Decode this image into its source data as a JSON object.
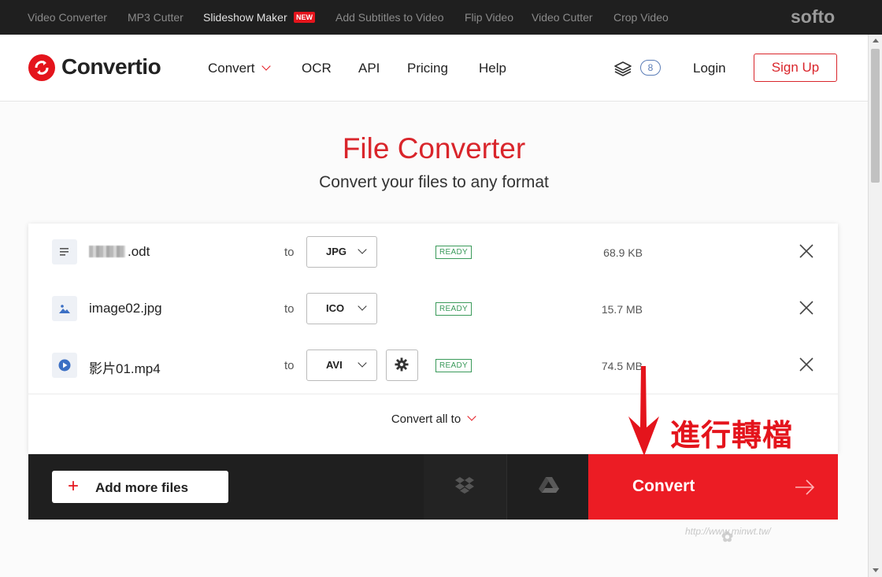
{
  "topbar": {
    "items": [
      {
        "label": "Video Converter"
      },
      {
        "label": "MP3 Cutter"
      },
      {
        "label": "Slideshow Maker"
      },
      {
        "label": "Add Subtitles to Video"
      },
      {
        "label": "Flip Video"
      },
      {
        "label": "Video Cutter"
      },
      {
        "label": "Crop Video"
      }
    ],
    "new_badge": "NEW",
    "brand": "softo"
  },
  "header": {
    "logo_text": "Convertio",
    "nav": [
      {
        "label": "Convert"
      },
      {
        "label": "OCR"
      },
      {
        "label": "API"
      },
      {
        "label": "Pricing"
      },
      {
        "label": "Help"
      }
    ],
    "layers_count": "8",
    "login": "Login",
    "signup": "Sign Up"
  },
  "hero": {
    "title": "File Converter",
    "subtitle": "Convert your files to any format"
  },
  "files": [
    {
      "name": ".odt",
      "to": "to",
      "format": "JPG",
      "status": "READY",
      "size": "68.9 KB",
      "icon": "document-icon"
    },
    {
      "name": "image02.jpg",
      "to": "to",
      "format": "ICO",
      "status": "READY",
      "size": "15.7 MB",
      "icon": "image-icon"
    },
    {
      "name": "影片01.mp4",
      "to": "to",
      "format": "AVI",
      "status": "READY",
      "size": "74.5 MB",
      "icon": "video-play-icon"
    }
  ],
  "convert_all": "Convert all to",
  "actions": {
    "add_more": "Add more files",
    "convert": "Convert"
  },
  "annotation": "進行轉檔",
  "watermark": "http://www.minwt.tw/",
  "colors": {
    "accent": "#e4141c",
    "ready": "#3a9a5a",
    "topbar": "#1f1f1f"
  }
}
